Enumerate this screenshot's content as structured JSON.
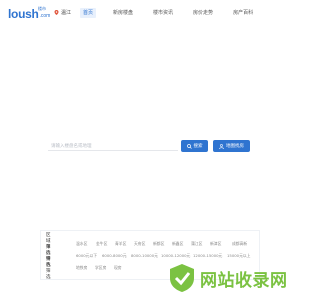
{
  "header": {
    "logo_text": "loush",
    "logo_suffix": ".com",
    "logo_sub": "楼市",
    "location": "温江",
    "nav": [
      "首页",
      "新房楼盘",
      "楼市资讯",
      "房价走势",
      "房产百科"
    ]
  },
  "search": {
    "placeholder": "请输入楼盘名或地理",
    "search_label": "搜索",
    "map_label": "地图找房"
  },
  "filters": [
    {
      "title": "区域筛选",
      "options": [
        "温水区",
        "金牛区",
        "青羊区",
        "天府区",
        "新都区",
        "新鑫区",
        "蒲江区",
        "新津区",
        "成都高新"
      ]
    },
    {
      "title": "单价筛选",
      "options": [
        "6000元以下",
        "6000-8000元",
        "8000-10000元",
        "10000-12000元",
        "12000-15000元",
        "15000元以上"
      ]
    },
    {
      "title": "特色筛选",
      "options": [
        "地铁房",
        "学区房",
        "现房"
      ]
    }
  ],
  "watermark": {
    "text": "网站收录网"
  },
  "colors": {
    "accent": "#2f74d0",
    "watermark": "#7bc242"
  }
}
